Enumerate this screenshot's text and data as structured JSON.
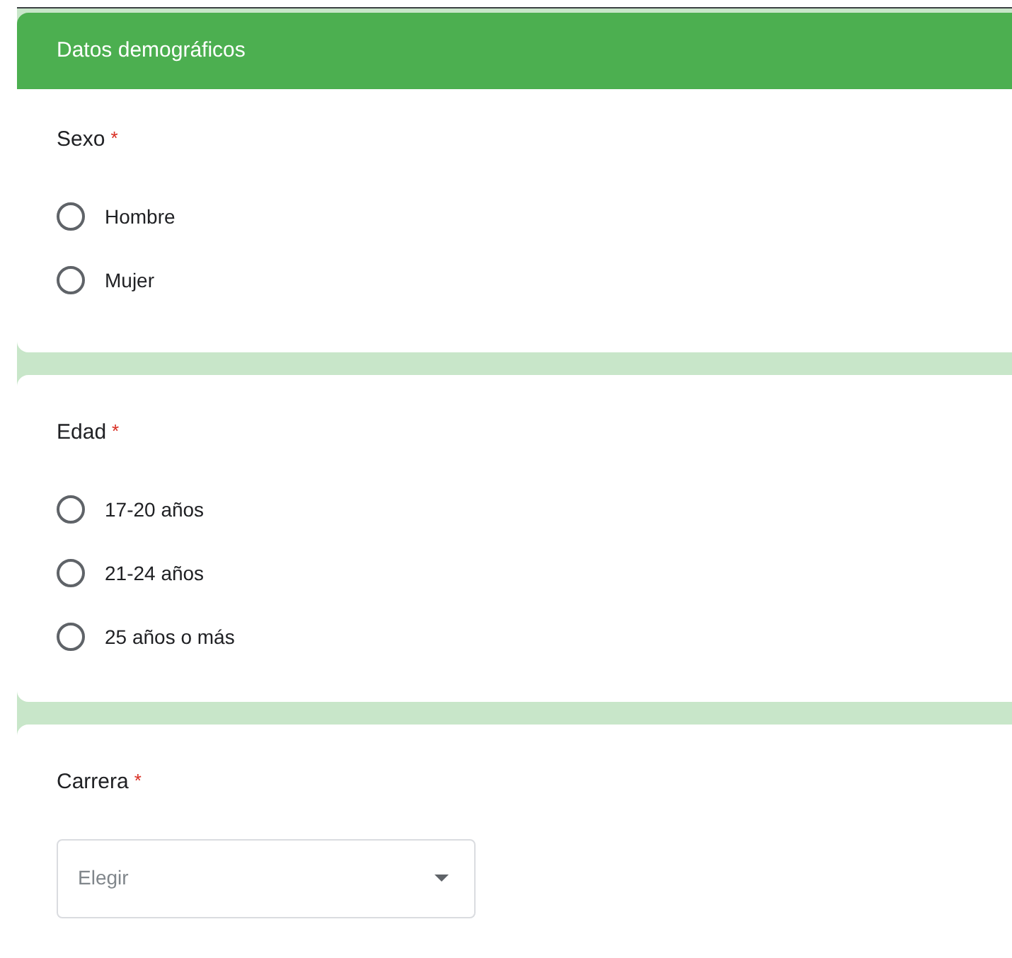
{
  "section": {
    "title": "Datos demográficos"
  },
  "questions": [
    {
      "kind": "radio",
      "label": "Sexo",
      "required_mark": "*",
      "options": [
        {
          "label": "Hombre",
          "selected": false
        },
        {
          "label": "Mujer",
          "selected": false
        }
      ]
    },
    {
      "kind": "radio",
      "label": "Edad",
      "required_mark": "*",
      "options": [
        {
          "label": "17-20 años",
          "selected": false
        },
        {
          "label": "21-24 años",
          "selected": false
        },
        {
          "label": "25 años o más",
          "selected": false
        }
      ]
    },
    {
      "kind": "dropdown",
      "label": "Carrera",
      "required_mark": "*",
      "placeholder": "Elegir"
    }
  ]
}
